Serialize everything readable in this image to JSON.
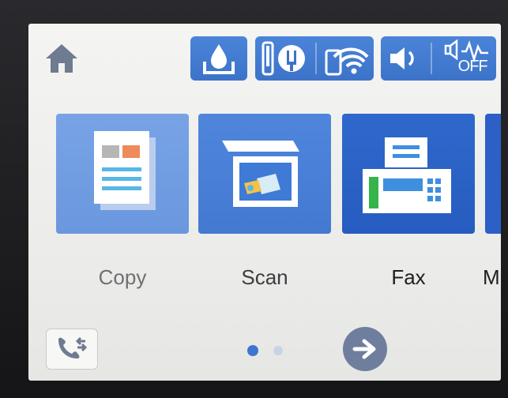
{
  "status_bar": {
    "home_icon": "home-icon",
    "ink_icon": "ink-level-icon",
    "network_icons": [
      "wifi-direct-icon",
      "wifi-icon"
    ],
    "sound_icons": [
      "speaker-icon",
      "quiet-mode-off-icon"
    ],
    "quiet_mode_text": "OFF"
  },
  "tiles": [
    {
      "label": "Copy",
      "icon": "copy-icon"
    },
    {
      "label": "Scan",
      "icon": "scan-icon"
    },
    {
      "label": "Fax",
      "icon": "fax-icon"
    },
    {
      "label": "M",
      "icon": "more-icon"
    }
  ],
  "bottom_bar": {
    "left_icon": "fax-log-icon",
    "page_indicator": {
      "current": 1,
      "total": 2
    },
    "next_icon": "arrow-right-icon"
  },
  "colors": {
    "accent": "#3c73c9",
    "tile_copy": "#6a97de",
    "tile_scan": "#4479d2",
    "tile_fax": "#275cc0"
  }
}
